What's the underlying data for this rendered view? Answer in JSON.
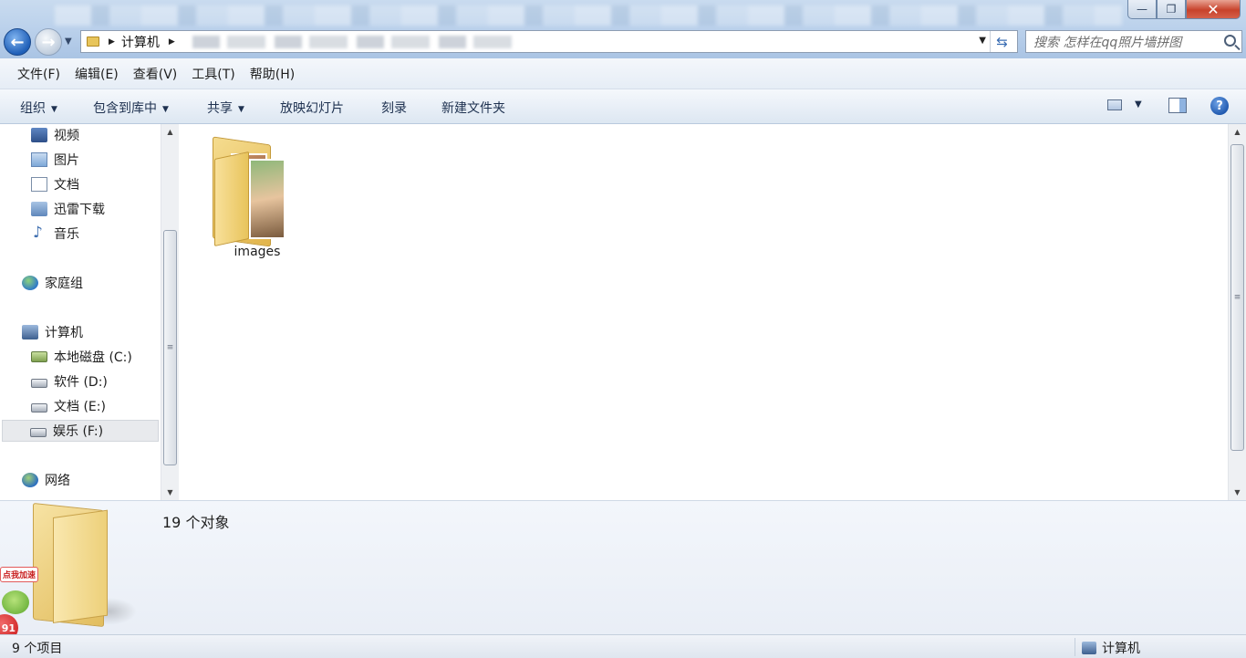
{
  "window": {
    "minimize_glyph": "—",
    "maximize_glyph": "❐",
    "close_glyph": "✕"
  },
  "address": {
    "root": "计算机",
    "search_placeholder": "搜索 怎样在qq照片墙拼图"
  },
  "menu": {
    "items": [
      "文件(F)",
      "编辑(E)",
      "查看(V)",
      "工具(T)",
      "帮助(H)"
    ]
  },
  "commands": {
    "organize": "组织",
    "include_library": "包含到库中",
    "share": "共享",
    "slideshow": "放映幻灯片",
    "burn": "刻录",
    "new_folder": "新建文件夹",
    "help_glyph": "?"
  },
  "nav": {
    "libraries": [
      "视频",
      "图片",
      "文档",
      "迅雷下载",
      "音乐"
    ],
    "homegroup": "家庭组",
    "computer": "计算机",
    "drives": [
      "本地磁盘 (C:)",
      "软件 (D:)",
      "文档 (E:)",
      "娱乐 (F:)"
    ],
    "selected_drive": "娱乐 (F:)",
    "network": "网络"
  },
  "content": {
    "items": [
      {
        "name": "images",
        "type": "folder"
      }
    ]
  },
  "details": {
    "count_text": "19 个对象",
    "promo_label": "点我加速",
    "promo_badge": "91"
  },
  "status": {
    "items_text": "9 个项目",
    "location": "计算机"
  },
  "icons": {
    "back": "arrow-left-icon",
    "forward": "arrow-right-icon",
    "refresh": "refresh-icon",
    "search": "search-icon",
    "help": "help-icon"
  },
  "colors": {
    "titlebar": "#bcd2ec",
    "close_button": "#c7422b",
    "link_text": "#1e3150"
  }
}
